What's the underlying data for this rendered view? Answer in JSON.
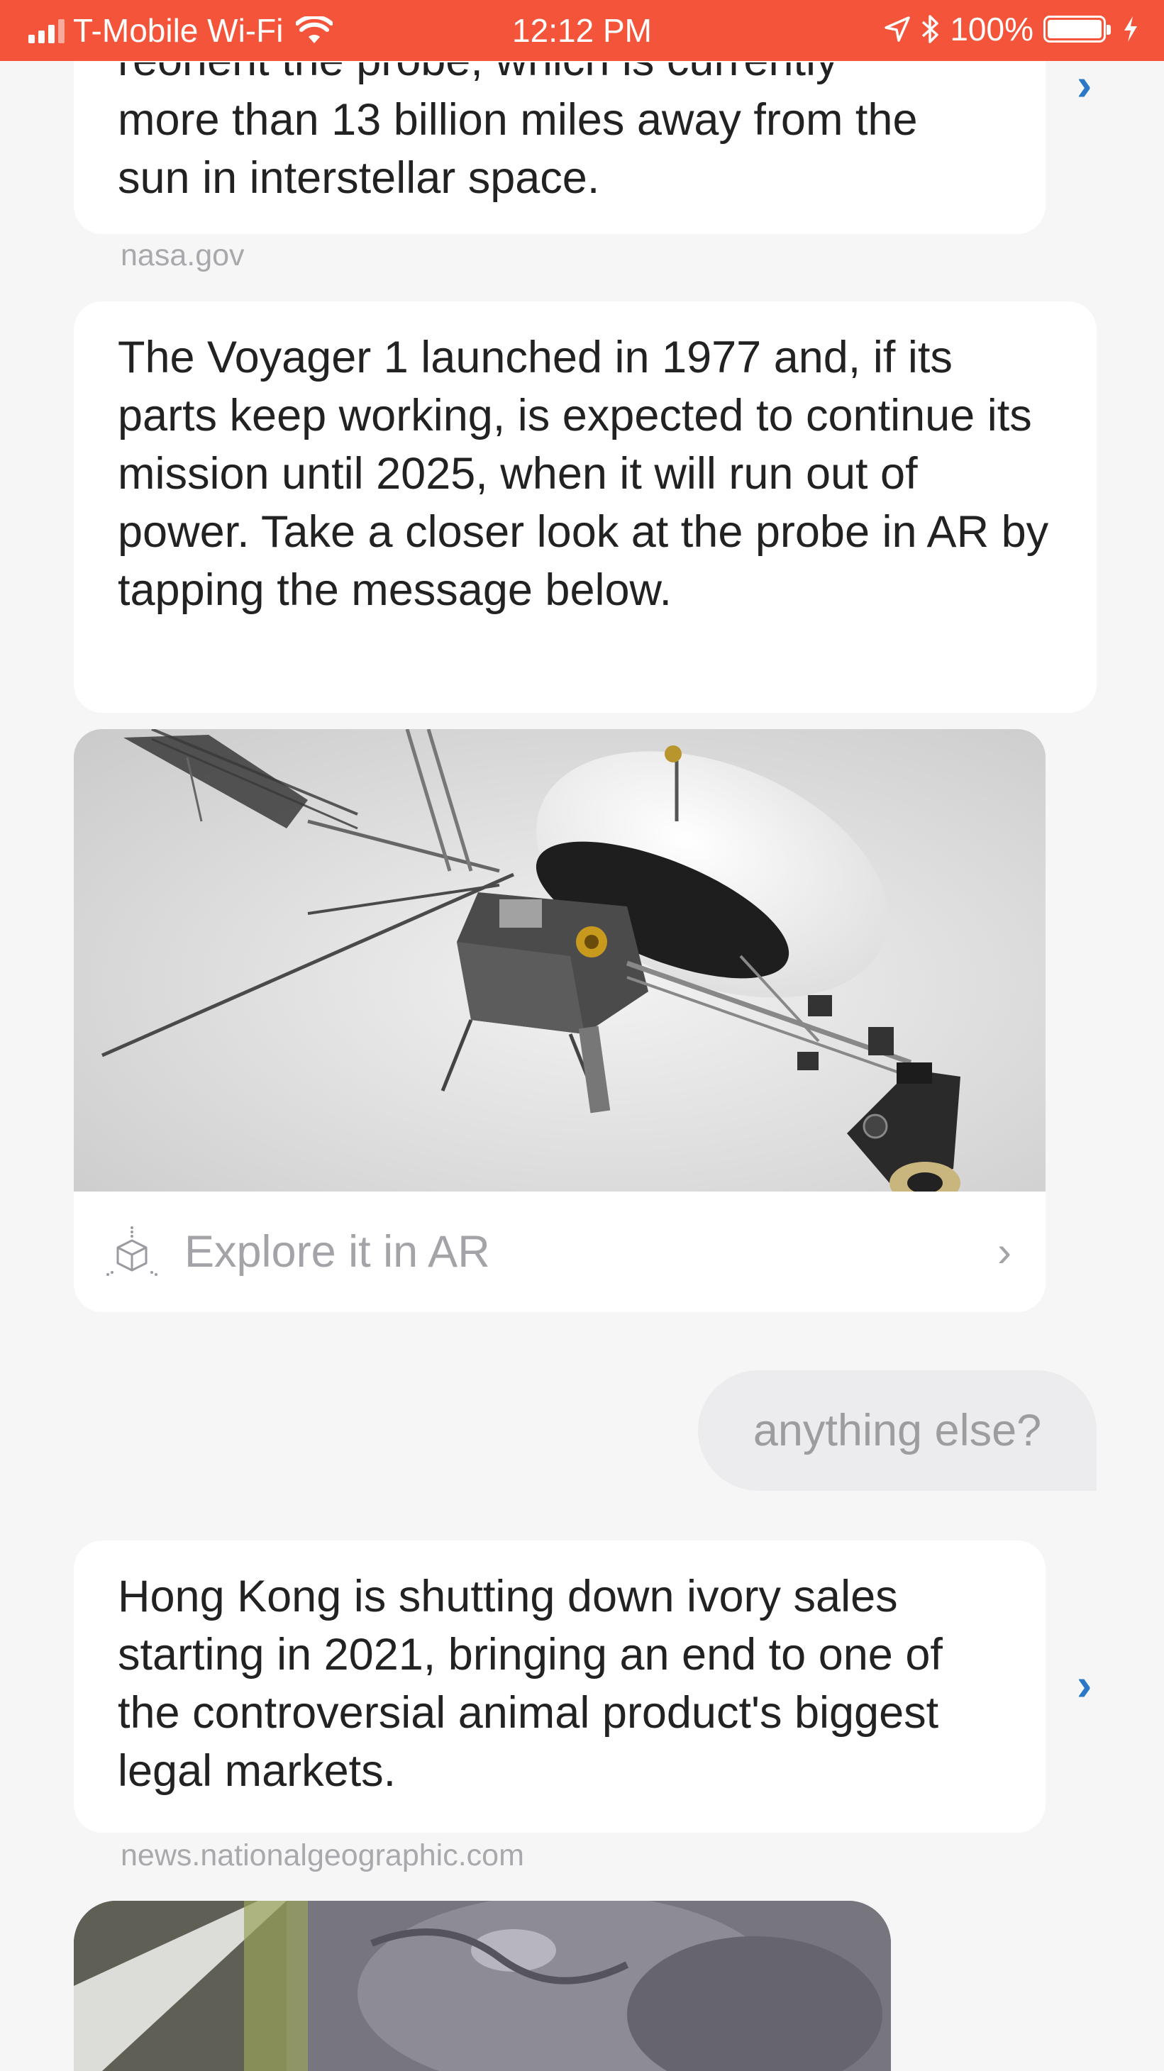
{
  "status_bar": {
    "carrier": "T-Mobile Wi-Fi",
    "time": "12:12 PM",
    "battery": "100%"
  },
  "messages": [
    {
      "type": "news",
      "partial_line": "reorient the probe, which is currently",
      "text": "more than 13 billion miles away from the sun in interstellar space.",
      "source": "nasa.gov"
    },
    {
      "type": "news",
      "text": "The Voyager 1 launched in 1977 and, if its parts keep working, is expected to continue its mission until 2025, when it will run out of power. Take a closer look at the probe in AR by tapping the message below."
    },
    {
      "type": "ar_card",
      "link_label": "Explore it in AR"
    },
    {
      "type": "user",
      "text": "anything else?"
    },
    {
      "type": "news",
      "text": "Hong Kong is shutting down ivory sales starting in 2021, bringing an end to one of the controversial animal product's biggest legal markets.",
      "source": "news.nationalgeographic.com"
    }
  ],
  "colors": {
    "status_bar": "#f4553a",
    "background": "#f6f6f7",
    "accent_chevron": "#2b78c5",
    "user_bubble": "#ececee"
  }
}
